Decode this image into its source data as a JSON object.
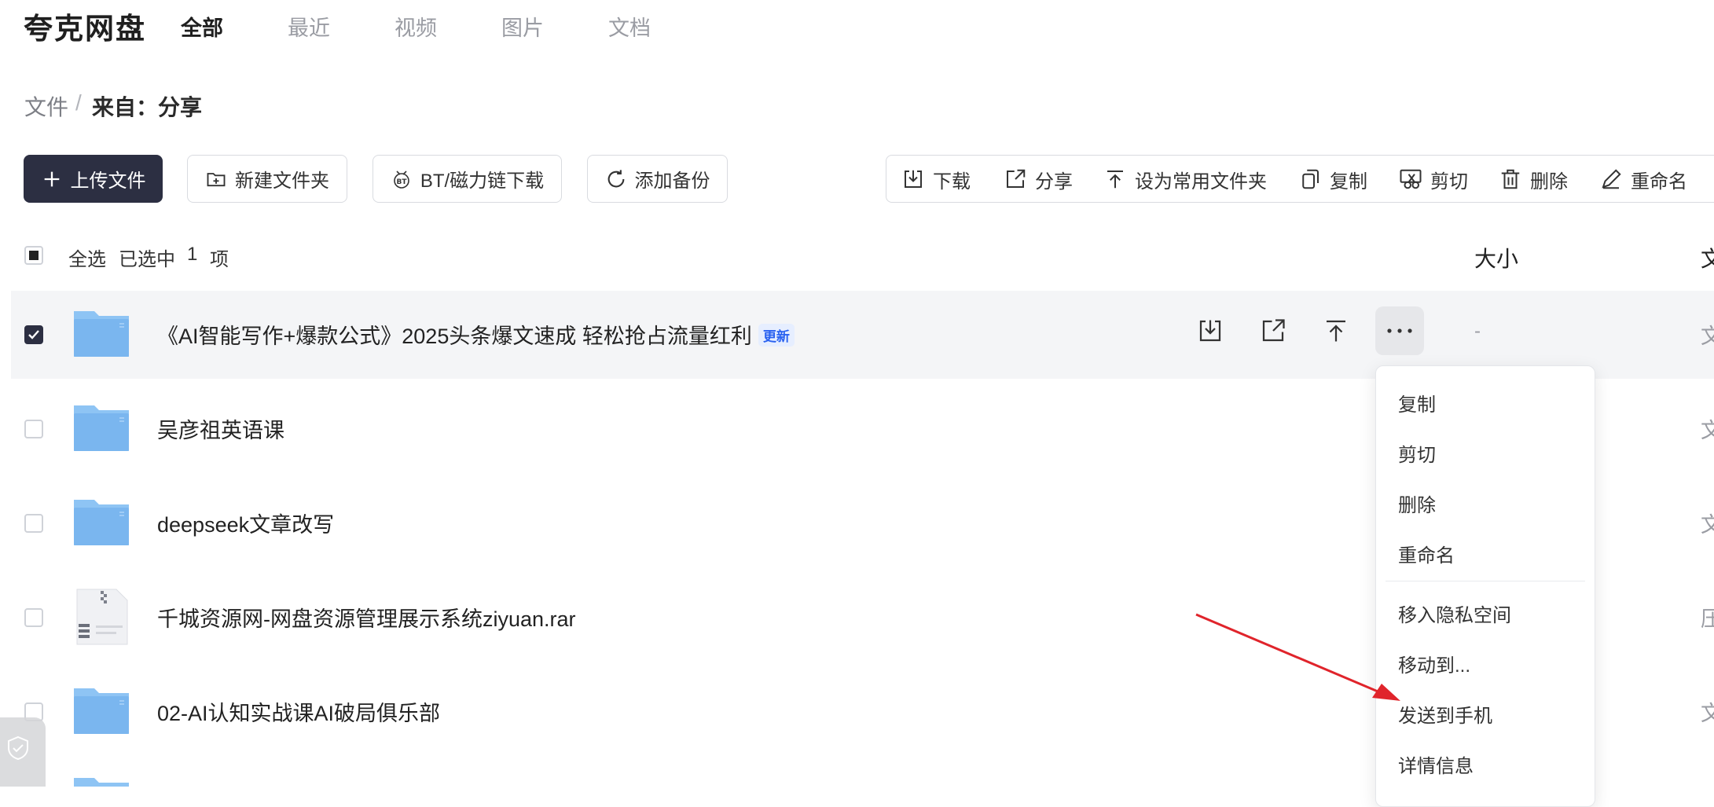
{
  "app": {
    "title": "夸克网盘"
  },
  "nav": {
    "tabs": [
      "全部",
      "最近",
      "视频",
      "图片",
      "文档"
    ],
    "active": "全部"
  },
  "breadcrumb": {
    "root": "文件",
    "separator": "/",
    "current": "来自：分享"
  },
  "actions": {
    "upload": "上传文件",
    "new_folder": "新建文件夹",
    "bt_download": "BT/磁力链下载",
    "add_backup": "添加备份"
  },
  "toolbar": {
    "download": "下载",
    "share": "分享",
    "set_common": "设为常用文件夹",
    "copy": "复制",
    "cut": "剪切",
    "delete": "删除",
    "rename": "重命名"
  },
  "list_header": {
    "select_all": "全选",
    "selected_prefix": "已选中",
    "selected_count": "1",
    "selected_suffix": "项",
    "size_col": "大小",
    "type_col_cut": "文"
  },
  "files": [
    {
      "name": "《AI智能写作+爆款公式》2025头条爆文速成 轻松抢占流量红利",
      "tag": "更新",
      "size": "-",
      "type_cut": "文",
      "selected": true,
      "icon": "folder-icon"
    },
    {
      "name": "吴彦祖英语课",
      "type_cut": "文",
      "selected": false,
      "icon": "folder-icon"
    },
    {
      "name": "deepseek文章改写",
      "type_cut": "文",
      "selected": false,
      "icon": "folder-icon"
    },
    {
      "name": "千城资源网-网盘资源管理展示系统ziyuan.rar",
      "type_cut": "压",
      "selected": false,
      "icon": "archive-icon"
    },
    {
      "name": "02-AI认知实战课AI破局俱乐部",
      "type_cut": "文",
      "selected": false,
      "icon": "folder-icon"
    }
  ],
  "context_menu": {
    "items": [
      "复制",
      "剪切",
      "删除",
      "重命名",
      "移入隐私空间",
      "移动到...",
      "发送到手机",
      "详情信息"
    ]
  },
  "colors": {
    "primary_button": "#2c2f42",
    "folder": "#7fb8f0",
    "annotation_arrow": "#e0242b",
    "tag": "#2a62f0"
  }
}
